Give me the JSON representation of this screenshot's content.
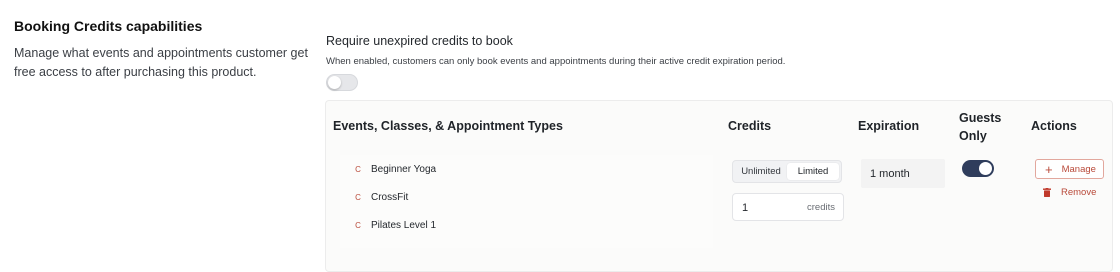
{
  "section": {
    "title": "Booking Credits capabilities",
    "description": "Manage what events and appointments customer get free access to after purchasing this product."
  },
  "require": {
    "title": "Require unexpired credits to book",
    "hint": "When enabled, customers can only book events and appointments during their active credit expiration period.",
    "enabled": false
  },
  "table": {
    "headers": {
      "events": "Events, Classes, & Appointment Types",
      "credits": "Credits",
      "expiration": "Expiration",
      "guests_line1": "Guests",
      "guests_line2": "Only",
      "actions": "Actions"
    },
    "row": {
      "items": [
        {
          "badge": "C",
          "name": "Beginner Yoga"
        },
        {
          "badge": "C",
          "name": "CrossFit"
        },
        {
          "badge": "C",
          "name": "Pilates Level 1"
        }
      ],
      "credit_mode_options": [
        "Unlimited",
        "Limited"
      ],
      "credit_mode_selected": "Limited",
      "credits_value": "1",
      "credits_unit": "credits",
      "expiration": "1 month",
      "guests_only": true,
      "manage_label": "Manage",
      "remove_label": "Remove"
    }
  },
  "colors": {
    "accent": "#b94a3a",
    "toggle_on": "#2f3d5c",
    "toggle_off": "#e6e7ea"
  },
  "icons": {
    "item_badge": "letter-c-badge",
    "manage": "plus-icon",
    "remove": "trash-icon"
  }
}
